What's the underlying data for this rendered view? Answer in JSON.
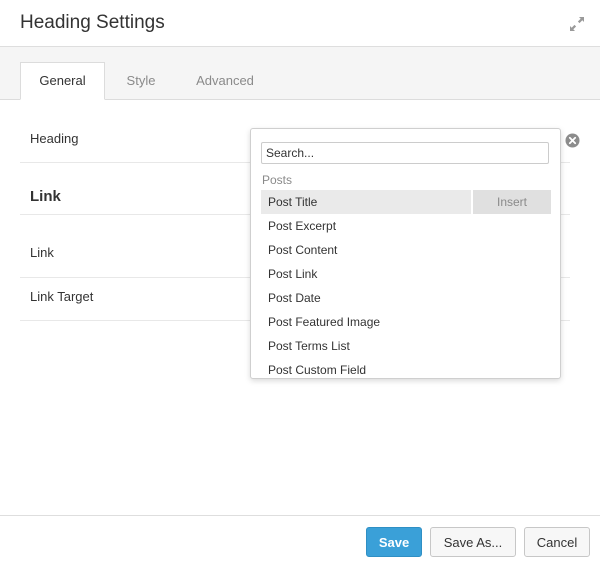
{
  "header": {
    "title": "Heading Settings"
  },
  "tabs": [
    {
      "label": "General",
      "active": true
    },
    {
      "label": "Style",
      "active": false
    },
    {
      "label": "Advanced",
      "active": false
    }
  ],
  "form": {
    "heading_label": "Heading",
    "link_section_title": "Link",
    "link_label": "Link",
    "link_target_label": "Link Target"
  },
  "dropdown": {
    "search_placeholder": "Search...",
    "group_label": "Posts",
    "insert_label": "Insert",
    "items": [
      "Post Title",
      "Post Excerpt",
      "Post Content",
      "Post Link",
      "Post Date",
      "Post Featured Image",
      "Post Terms List",
      "Post Custom Field"
    ]
  },
  "footer": {
    "save_label": "Save",
    "save_as_label": "Save As...",
    "cancel_label": "Cancel"
  },
  "colors": {
    "primary": "#3aa0d8",
    "tabs_bg": "#f5f5f5",
    "hover_bg": "#eaeaea"
  },
  "icons": {
    "expand": "expand-icon",
    "clear": "clear-icon"
  }
}
